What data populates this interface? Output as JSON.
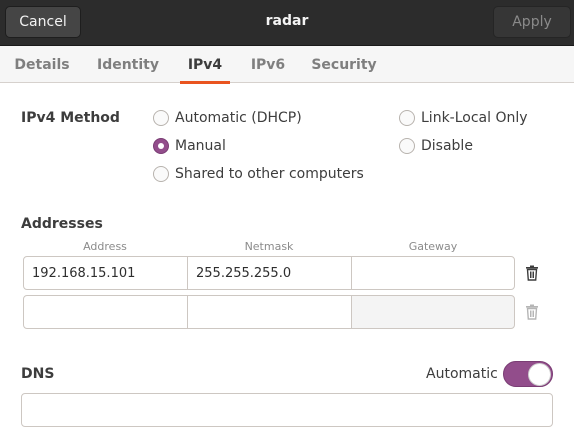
{
  "header": {
    "cancel_label": "Cancel",
    "title": "radar",
    "apply_label": "Apply"
  },
  "tabs": [
    {
      "label": "Details"
    },
    {
      "label": "Identity"
    },
    {
      "label": "IPv4",
      "active": true
    },
    {
      "label": "IPv6"
    },
    {
      "label": "Security"
    }
  ],
  "ipv4": {
    "method_label": "IPv4 Method",
    "methods": [
      {
        "label": "Automatic (DHCP)",
        "checked": false
      },
      {
        "label": "Link-Local Only",
        "checked": false
      },
      {
        "label": "Manual",
        "checked": true
      },
      {
        "label": "Disable",
        "checked": false
      },
      {
        "label": "Shared to other computers",
        "checked": false
      }
    ]
  },
  "addresses": {
    "label": "Addresses",
    "columns": [
      "Address",
      "Netmask",
      "Gateway"
    ],
    "rows": [
      {
        "address": "192.168.15.101",
        "netmask": "255.255.255.0",
        "gateway": ""
      },
      {
        "address": "",
        "netmask": "",
        "gateway": ""
      }
    ]
  },
  "dns": {
    "label": "DNS",
    "automatic_label": "Automatic",
    "automatic_on": true,
    "value": ""
  },
  "colors": {
    "accent": "#924d8b",
    "tab_underline": "#e95420",
    "headerbar": "#2c2c2c"
  }
}
